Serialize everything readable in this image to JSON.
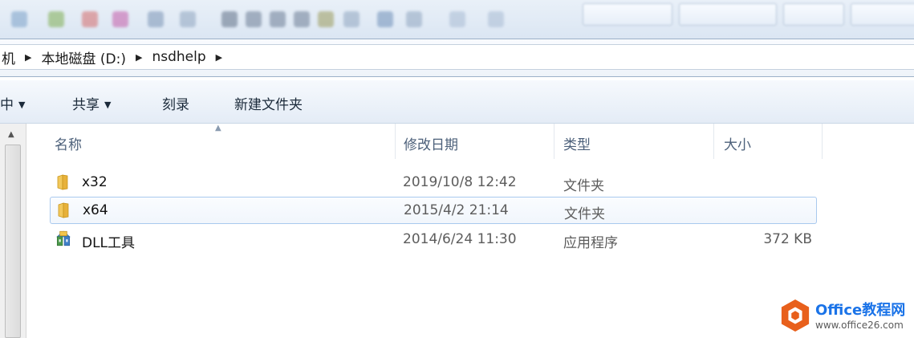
{
  "breadcrumb": {
    "items": [
      "机",
      "本地磁盘 (D:)",
      "nsdhelp"
    ]
  },
  "toolbar": {
    "partial_label": "中",
    "share_label": "共享",
    "burn_label": "刻录",
    "new_folder_label": "新建文件夹"
  },
  "columns": {
    "name": "名称",
    "date": "修改日期",
    "type": "类型",
    "size": "大小"
  },
  "files": [
    {
      "name": "x32",
      "date": "2019/10/8 12:42",
      "type": "文件夹",
      "size": "",
      "icon": "folder-icon"
    },
    {
      "name": "x64",
      "date": "2015/4/2 21:14",
      "type": "文件夹",
      "size": "",
      "icon": "folder-icon"
    },
    {
      "name": "DLL工具",
      "date": "2014/6/24 11:30",
      "type": "应用程序",
      "size": "372 KB",
      "icon": "application-icon"
    }
  ],
  "selected_row": 1,
  "watermark": {
    "brand": "Office教程网",
    "url": "www.office26.com"
  },
  "colors": {
    "selection_border": "#a9c9ee",
    "header_text": "#4c607a",
    "watermark_orange": "#e8601c",
    "watermark_blue": "#1a73e8"
  }
}
